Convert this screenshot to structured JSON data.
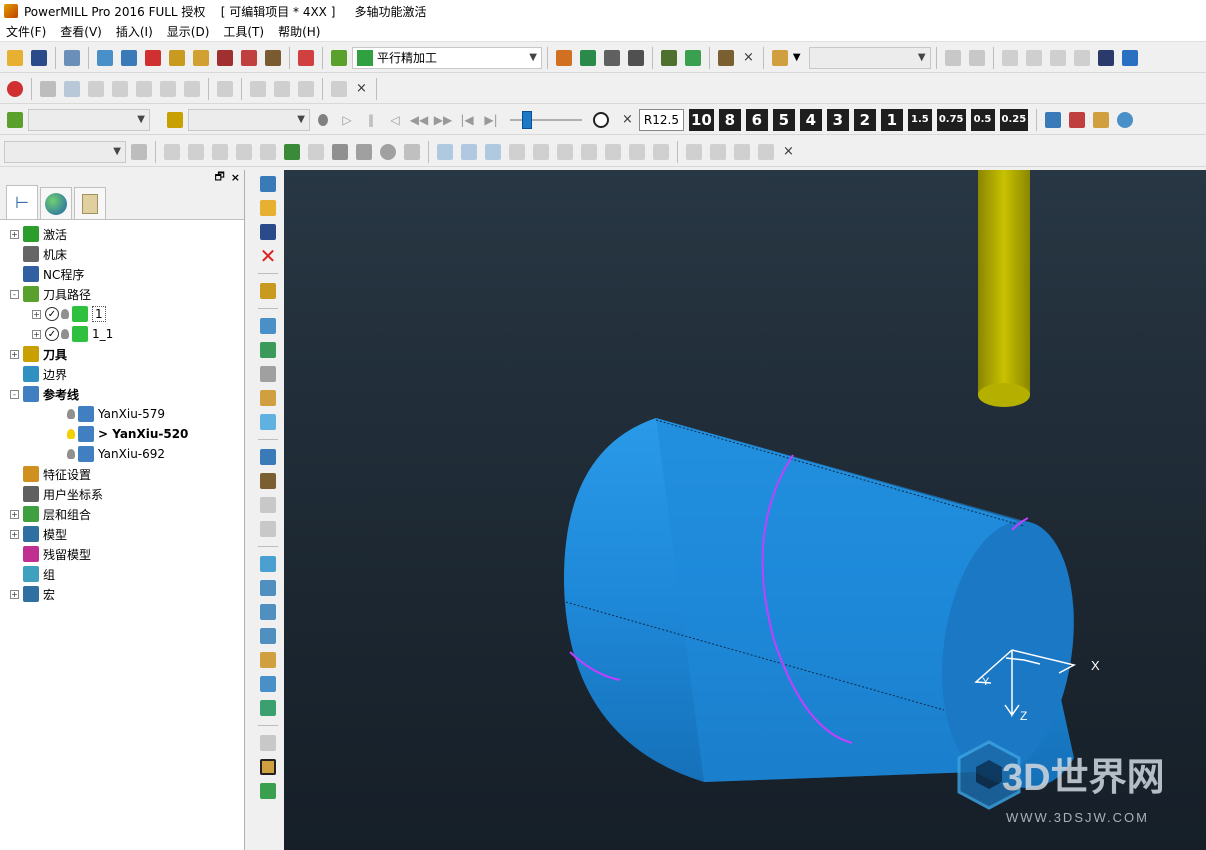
{
  "window": {
    "title": "PowerMILL Pro 2016 FULL 授权    [ 可编辑项目 * 4XX ]     多轴功能激活"
  },
  "menu": {
    "items": [
      "文件(F)",
      "查看(V)",
      "插入(I)",
      "显示(D)",
      "工具(T)",
      "帮助(H)"
    ]
  },
  "toolbar1": {
    "strategy_combo": "平行精加工"
  },
  "toolbar3": {
    "speed_labels": [
      "R12.5",
      "10",
      "8",
      "6",
      "5",
      "4",
      "3",
      "2",
      "1",
      "1.5",
      "0.75",
      "0.5",
      "0.25"
    ],
    "slider_level": 0.2
  },
  "explorer": {
    "tree": [
      {
        "label": "激活",
        "expand": "+",
        "indent": 0,
        "color": "#2a9d2a",
        "icon": "play-icon"
      },
      {
        "label": "机床",
        "expand": "",
        "indent": 0,
        "color": "#666666",
        "icon": "machine-icon"
      },
      {
        "label": "NC程序",
        "expand": "",
        "indent": 0,
        "color": "#3060a0",
        "icon": "nc-program-icon"
      },
      {
        "label": "刀具路径",
        "expand": "-",
        "indent": 0,
        "color": "#5aa02c",
        "icon": "toolpath-icon"
      },
      {
        "label": "1",
        "expand": "+",
        "indent": 1,
        "color": "#30c040",
        "icon": "toolpath-item-icon",
        "box": true
      },
      {
        "label": "1_1",
        "expand": "+",
        "indent": 1,
        "color": "#30c040",
        "icon": "toolpath-item-icon"
      },
      {
        "label": "刀具",
        "expand": "+",
        "indent": 0,
        "color": "#c8a000",
        "icon": "tool-icon",
        "bold": true
      },
      {
        "label": "边界",
        "expand": "",
        "indent": 0,
        "color": "#3090c0",
        "icon": "boundary-icon"
      },
      {
        "label": "参考线",
        "expand": "-",
        "indent": 0,
        "color": "#4080c0",
        "icon": "pattern-icon",
        "bold": true
      },
      {
        "label": "YanXiu-579",
        "expand": "",
        "indent": 2,
        "color": "#4080c0",
        "icon": "pattern-item-icon"
      },
      {
        "label": "> YanXiu-520",
        "expand": "",
        "indent": 2,
        "color": "#4080c0",
        "icon": "pattern-item-icon",
        "bold": true,
        "active": true
      },
      {
        "label": "YanXiu-692",
        "expand": "",
        "indent": 2,
        "color": "#4080c0",
        "icon": "pattern-item-icon"
      },
      {
        "label": "特征设置",
        "expand": "",
        "indent": 0,
        "color": "#d09020",
        "icon": "feature-icon"
      },
      {
        "label": "用户坐标系",
        "expand": "",
        "indent": 0,
        "color": "#606060",
        "icon": "workplane-icon"
      },
      {
        "label": "层和组合",
        "expand": "+",
        "indent": 0,
        "color": "#40a040",
        "icon": "layer-icon"
      },
      {
        "label": "模型",
        "expand": "+",
        "indent": 0,
        "color": "#3070a0",
        "icon": "model-icon"
      },
      {
        "label": "残留模型",
        "expand": "",
        "indent": 0,
        "color": "#c03090",
        "icon": "stock-model-icon"
      },
      {
        "label": "组",
        "expand": "",
        "indent": 0,
        "color": "#40a0c0",
        "icon": "group-icon"
      },
      {
        "label": "宏",
        "expand": "+",
        "indent": 0,
        "color": "#3070a0",
        "icon": "macro-icon"
      }
    ]
  },
  "viewport": {
    "axis_x": "X",
    "axis_y": "Y",
    "axis_z": "Z",
    "watermark_main": "3D世界网",
    "watermark_url": "WWW.3DSJW.COM",
    "colors": {
      "background": "#1c2731",
      "cylinder": "#1e88d8",
      "tool": "#b5b000",
      "curve": "#c040ff"
    }
  }
}
